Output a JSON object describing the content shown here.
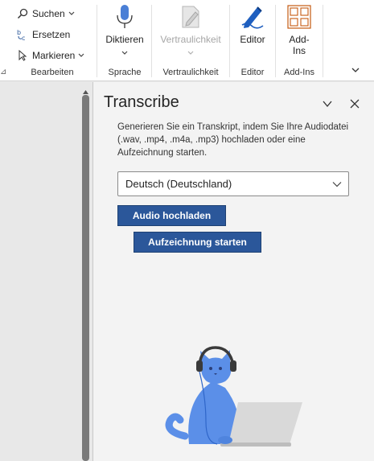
{
  "ribbon": {
    "edit_group": {
      "items": [
        {
          "label": "Suchen",
          "icon": "search-icon",
          "has_dropdown": true
        },
        {
          "label": "Ersetzen",
          "icon": "replace-icon",
          "has_dropdown": false
        },
        {
          "label": "Markieren",
          "icon": "select-icon",
          "has_dropdown": true
        }
      ],
      "label": "Bearbeiten"
    },
    "groups": [
      {
        "button": "Diktieren",
        "icon": "microphone-icon",
        "label": "Sprache",
        "enabled": true
      },
      {
        "button": "Vertraulichkeit",
        "icon": "sensitivity-icon",
        "label": "Vertraulichkeit",
        "enabled": false
      },
      {
        "button": "Editor",
        "icon": "editor-pen-icon",
        "label": "Editor",
        "enabled": true
      },
      {
        "button_line1": "Add-",
        "button_line2": "Ins",
        "icon": "add-ins-grid-icon",
        "label": "Add-Ins",
        "enabled": true
      }
    ]
  },
  "pane": {
    "title": "Transcribe",
    "description": "Generieren Sie ein Transkript, indem Sie Ihre Audiodatei (.wav, .mp4, .m4a, .mp3) hochladen oder eine Aufzeichnung starten.",
    "language_select": "Deutsch (Deutschland)",
    "upload_button": "Audio hochladen",
    "record_button": "Aufzeichnung starten"
  },
  "colors": {
    "accent": "#2b579a",
    "editor_blue": "#1f5fbf",
    "addins_red": "#c55a11",
    "cat_blue": "#5b8fe8",
    "pane_bg": "#f3f3f3"
  }
}
